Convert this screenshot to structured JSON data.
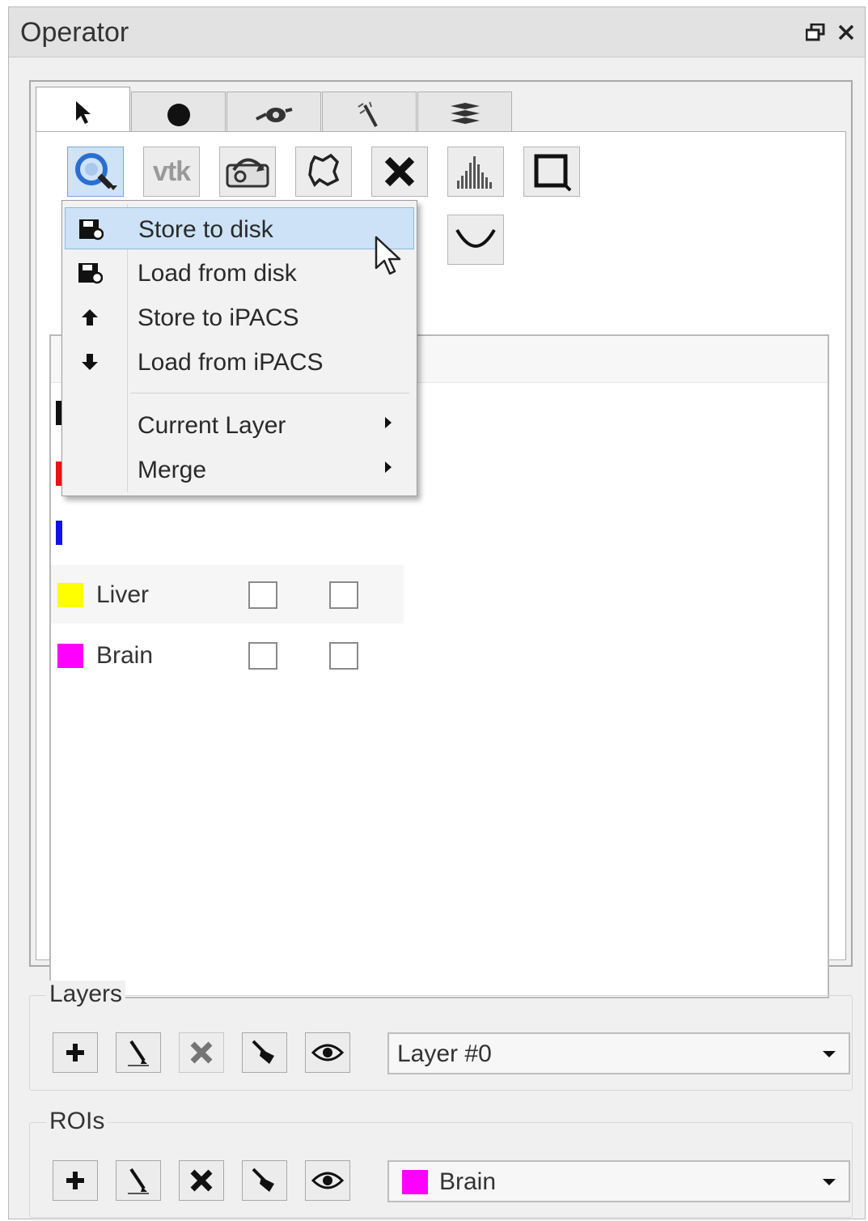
{
  "window": {
    "title": "Operator"
  },
  "tabs": [
    {
      "icon": "pointer-arrow-icon",
      "active": true
    },
    {
      "icon": "filled-circle-icon",
      "active": false
    },
    {
      "icon": "eye-drop-icon",
      "active": false
    },
    {
      "icon": "magic-wand-icon",
      "active": false
    },
    {
      "icon": "stack-layers-icon",
      "active": false
    }
  ],
  "toolbar_icons": [
    "segmentation-menu-icon",
    "vtk-icon",
    "disk-sync-icon",
    "lasso-icon",
    "delete-x-icon",
    "histogram-icon",
    "square-outline-icon",
    "curve-icon"
  ],
  "toolbar": {
    "vtk_label": "vtk"
  },
  "context_menu": {
    "items": [
      {
        "label": "Store to disk",
        "icon": "floppy-disk-icon",
        "hover": true
      },
      {
        "label": "Load from disk",
        "icon": "floppy-disk-icon",
        "hover": false
      },
      {
        "label": "Store to iPACS",
        "icon": "arrow-up-icon",
        "hover": false
      },
      {
        "label": "Load from iPACS",
        "icon": "arrow-down-icon",
        "hover": false
      }
    ],
    "submenus": [
      {
        "label": "Current Layer"
      },
      {
        "label": "Merge"
      }
    ]
  },
  "segments": {
    "hidden_colors": [
      "#111111",
      "#ee1111",
      "#1111ee"
    ],
    "rows": [
      {
        "name": "Liver",
        "color": "#ffff00",
        "checked_a": false,
        "checked_b": false
      },
      {
        "name": "Brain",
        "color": "#ff00ff",
        "checked_a": false,
        "checked_b": false
      }
    ]
  },
  "layers": {
    "title": "Layers",
    "selected": "Layer #0",
    "buttons": [
      "add-icon",
      "edit-pencil-icon",
      "remove-x-icon",
      "broom-icon",
      "eye-icon"
    ]
  },
  "rois": {
    "title": "ROIs",
    "selected": "Brain",
    "selected_color": "#ff00ff",
    "buttons": [
      "add-icon",
      "edit-pencil-icon",
      "remove-x-icon",
      "broom-icon",
      "eye-icon"
    ]
  }
}
